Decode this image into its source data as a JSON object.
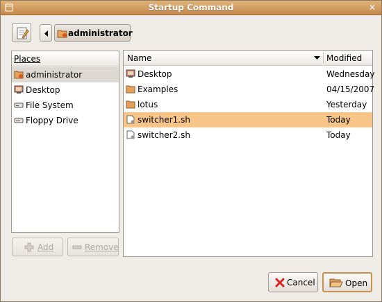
{
  "window": {
    "title": "Startup Command"
  },
  "pathbar": {
    "current": "administrator"
  },
  "places": {
    "header": "Places",
    "items": [
      {
        "label": "administrator",
        "icon": "home-folder-icon"
      },
      {
        "label": "Desktop",
        "icon": "desktop-icon"
      },
      {
        "label": "File System",
        "icon": "drive-icon"
      },
      {
        "label": "Floppy Drive",
        "icon": "floppy-icon"
      }
    ],
    "add_label": "Add",
    "remove_label": "Remove"
  },
  "files": {
    "col_name": "Name",
    "col_modified": "Modified",
    "rows": [
      {
        "name": "Desktop",
        "modified": "Wednesday",
        "icon": "desktop-icon"
      },
      {
        "name": "Examples",
        "modified": "04/15/2007",
        "icon": "folder-icon"
      },
      {
        "name": "lotus",
        "modified": "Yesterday",
        "icon": "folder-icon"
      },
      {
        "name": "switcher1.sh",
        "modified": "Today",
        "icon": "script-file-icon"
      },
      {
        "name": "switcher2.sh",
        "modified": "Today",
        "icon": "script-file-icon"
      }
    ]
  },
  "actions": {
    "cancel_label": "Cancel",
    "open_label": "Open"
  },
  "colors": {
    "titlebar": "#c4884b",
    "selection": "#f7c587",
    "accent": "#c9914e"
  }
}
